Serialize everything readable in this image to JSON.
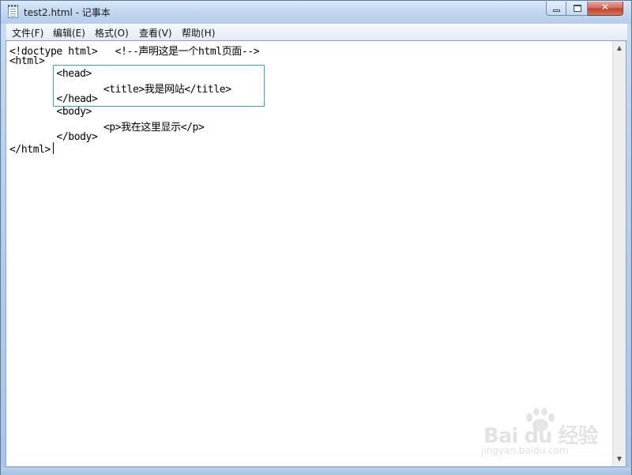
{
  "window": {
    "title": "test2.html - 记事本",
    "controls": {
      "minimize": "",
      "maximize": "",
      "close": "✕"
    }
  },
  "menu": [
    "文件(F)",
    "编辑(E)",
    "格式(O)",
    "查看(V)",
    "帮助(H)"
  ],
  "editor": {
    "lines": [
      "<!doctype html>   <!--声明这是一个html页面-->",
      "<html>",
      "        <head>",
      "                <title>我是网站</title>",
      "        </head>",
      "        <body>",
      "                <p>我在这里显示</p>",
      "        </body>",
      "</html>"
    ]
  },
  "scrollbar": {
    "up": "▲",
    "down": "▼"
  },
  "watermark": {
    "brand": "Bai du 经验",
    "url": "jingyan.baidu.com"
  },
  "colors": {
    "highlight_border": "#3aa6b5",
    "close_button": "#c0412e"
  }
}
